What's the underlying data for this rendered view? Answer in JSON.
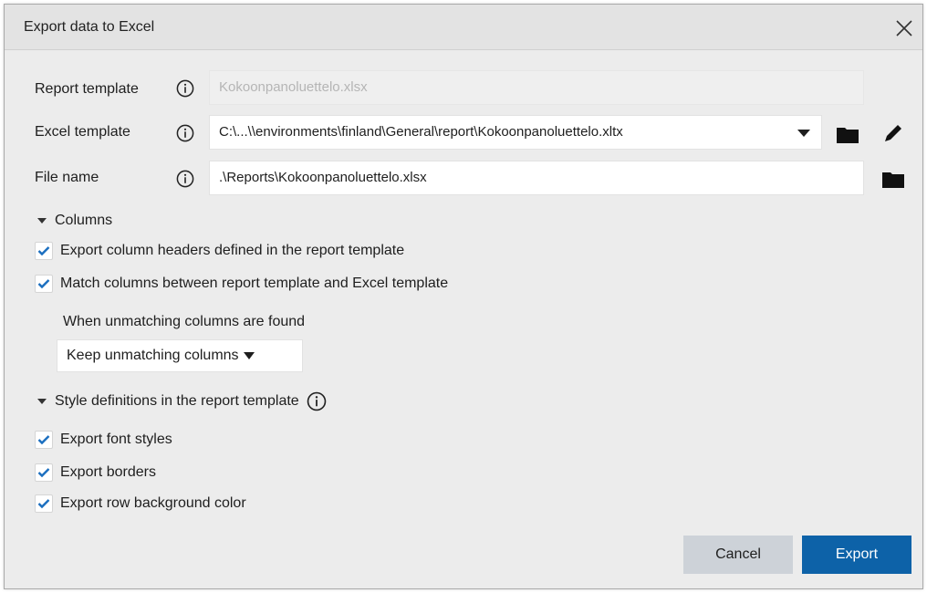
{
  "dialog": {
    "title": "Export data to Excel"
  },
  "form": {
    "report_template": {
      "label": "Report template",
      "value": "Kokoonpanoluettelo.xlsx"
    },
    "excel_template": {
      "label": "Excel template",
      "value": "C:\\...\\\\environments\\finland\\General\\report\\Kokoonpanoluettelo.xltx"
    },
    "file_name": {
      "label": "File name",
      "value": ".\\Reports\\Kokoonpanoluettelo.xlsx"
    }
  },
  "columns": {
    "header": "Columns",
    "options": [
      {
        "label": "Export column headers defined in the report template",
        "checked": true
      },
      {
        "label": "Match columns between report template and Excel template",
        "checked": true
      }
    ],
    "unmatching_label": "When unmatching columns are found",
    "unmatching_selected": "Keep unmatching columns"
  },
  "styles": {
    "header": "Style definitions in the report template",
    "options": [
      {
        "label": "Export font styles",
        "checked": true
      },
      {
        "label": "Export borders",
        "checked": true
      },
      {
        "label": "Export row background color",
        "checked": true
      }
    ]
  },
  "buttons": {
    "cancel": "Cancel",
    "export": "Export"
  },
  "colors": {
    "accent": "#0d62a8",
    "check": "#1a6ebf"
  }
}
